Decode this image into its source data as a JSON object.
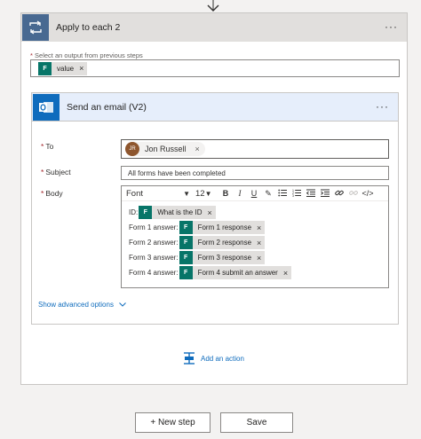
{
  "apply_each": {
    "title": "Apply to each 2",
    "more": "···",
    "select_label": "Select an output from previous steps",
    "required_mark": "*",
    "token": {
      "label": "value",
      "icon": "forms-icon"
    }
  },
  "email": {
    "title": "Send an email (V2)",
    "more": "···",
    "to": {
      "label": "To",
      "person_name": "Jon Russell",
      "initials": "JR",
      "avatar_color": "#8e562e"
    },
    "subject": {
      "label": "Subject",
      "value": "All forms have been completed"
    },
    "body": {
      "label": "Body",
      "toolbar": {
        "font": "Font",
        "size": "12",
        "buttons": [
          "B",
          "I",
          "U",
          "✎",
          "list-bullet",
          "list-numbered",
          "outdent",
          "indent",
          "link",
          "unlink",
          "</>"
        ]
      },
      "lines": [
        {
          "label": "ID:",
          "token": "What is the ID"
        },
        {
          "label": "Form 1 answer:",
          "token": "Form 1 response"
        },
        {
          "label": "Form 2 answer:",
          "token": "Form 2 response"
        },
        {
          "label": "Form 3 answer:",
          "token": "Form 3 response"
        },
        {
          "label": "Form 4 answer:",
          "token": "Form 4 submit an answer"
        }
      ]
    },
    "advanced_options": "Show advanced options"
  },
  "add_action": "Add an action",
  "footer": {
    "new_step": "+ New step",
    "save": "Save"
  },
  "colors": {
    "accent": "#0f6cbd",
    "apply_icon_bg": "#486991",
    "forms_token": "#077568",
    "required": "#a4262c"
  }
}
